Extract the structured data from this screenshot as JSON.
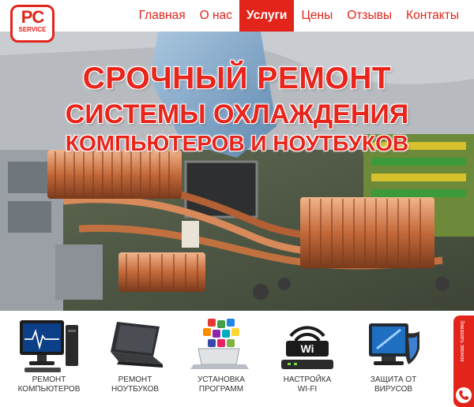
{
  "brand": {
    "logo_main": "PC",
    "logo_sub": "SERVICE",
    "accent": "#e3241b"
  },
  "nav": [
    {
      "label": "Главная",
      "active": false
    },
    {
      "label": "О нас",
      "active": false
    },
    {
      "label": "Услуги",
      "active": true
    },
    {
      "label": "Цены",
      "active": false
    },
    {
      "label": "Отзывы",
      "active": false
    },
    {
      "label": "Контакты",
      "active": false
    }
  ],
  "hero": {
    "line1": "СРОЧНЫЙ РЕМОНТ",
    "line2": "СИСТЕМЫ ОХЛАЖДЕНИЯ",
    "line3": "КОМПЬЮТЕРОВ И НОУТБУКОВ"
  },
  "services": [
    {
      "label_top": "РЕМОНТ",
      "label_bottom": "КОМПЬЮТЕРОВ",
      "icon": "desktop-computer-icon"
    },
    {
      "label_top": "РЕМОНТ",
      "label_bottom": "НОУТБУКОВ",
      "icon": "laptop-icon"
    },
    {
      "label_top": "УСТАНОВКА",
      "label_bottom": "ПРОГРАММ",
      "icon": "app-install-icon"
    },
    {
      "label_top": "НАСТРОЙКА",
      "label_bottom": "WI-FI",
      "icon": "wifi-router-icon"
    },
    {
      "label_top": "ЗАЩИТА ОТ",
      "label_bottom": "ВИРУСОВ",
      "icon": "antivirus-shield-icon"
    }
  ],
  "callback": {
    "label": "Заказать звонок",
    "icon": "phone-icon"
  }
}
